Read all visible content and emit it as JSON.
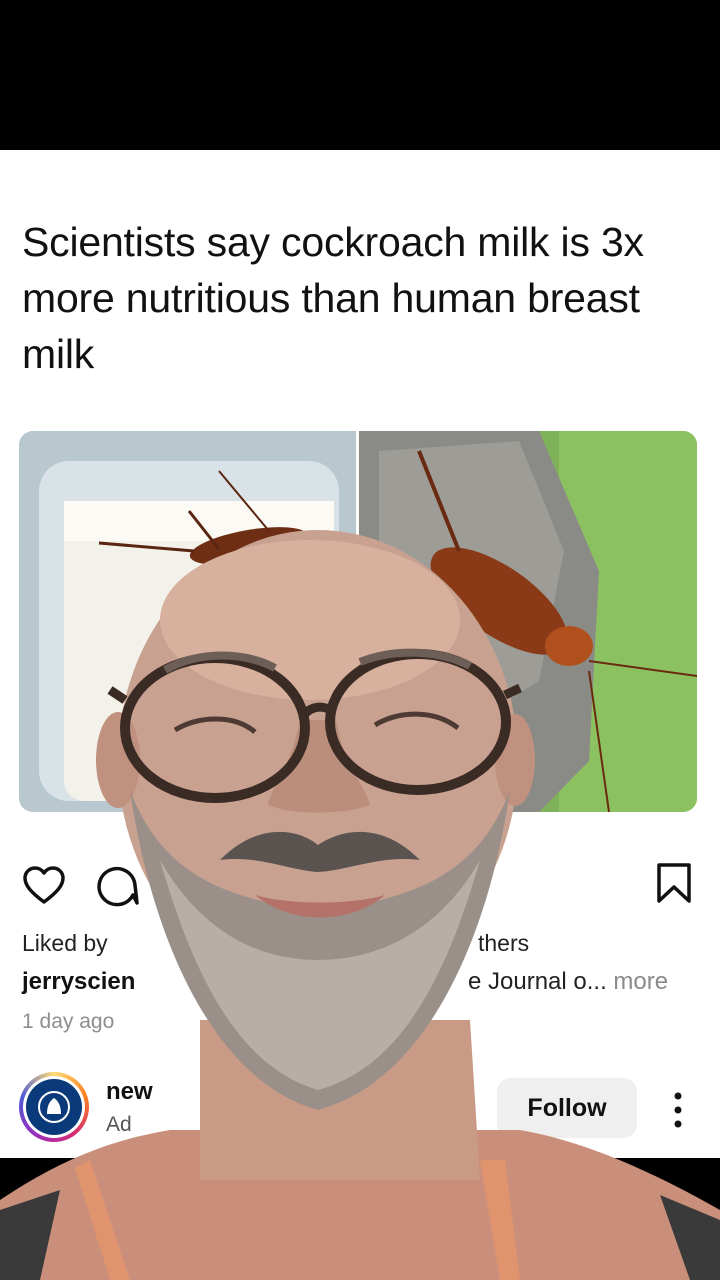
{
  "post": {
    "headline": "Scientists say cockroach milk is 3x more nutritious than human breast milk",
    "liked_prefix": "Liked by",
    "liked_suffix": "thers",
    "caption_user": "jerryscien",
    "caption_text": "e Journal o...",
    "caption_more": "more",
    "time": "1 day ago"
  },
  "account": {
    "name": "new",
    "subtitle": "Ad",
    "follow_label": "Follow"
  },
  "icons": {
    "like": "heart-icon",
    "comment": "comment-icon",
    "save": "bookmark-icon",
    "more": "more-vertical-icon"
  },
  "colors": {
    "background": "#ffffff",
    "follow_button_bg": "#efefef",
    "more_text": "#8a8a8a",
    "avatar_ring": "#d62976"
  }
}
